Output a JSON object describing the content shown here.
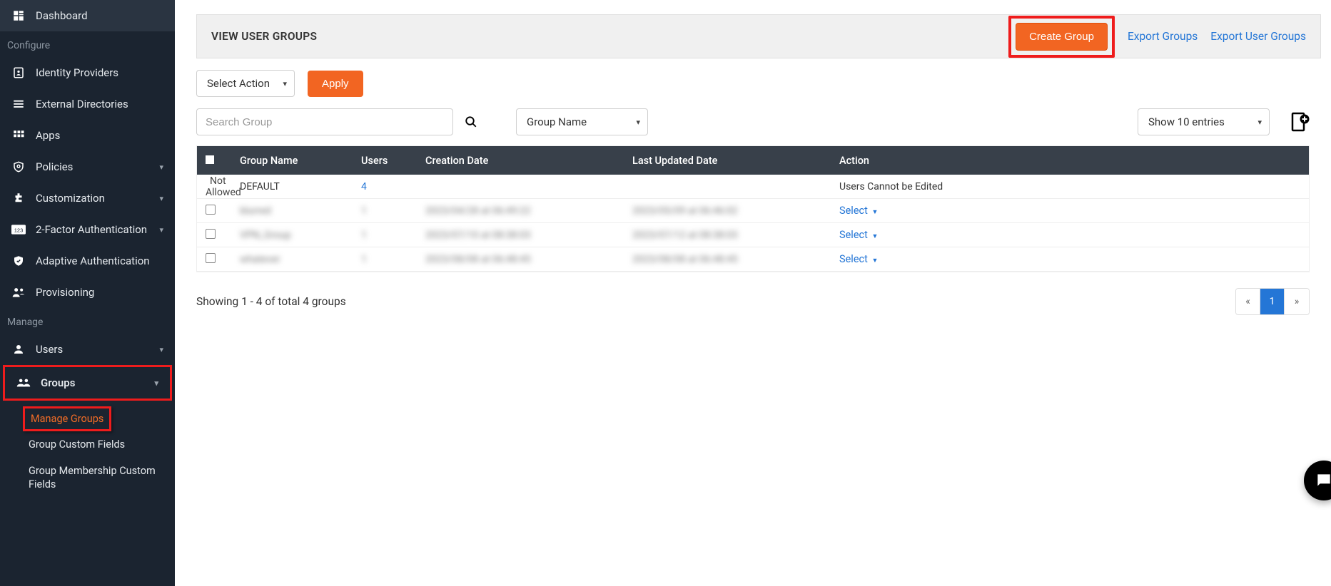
{
  "sidebar": {
    "items": [
      {
        "label": "Dashboard"
      },
      {
        "label": "Identity Providers"
      },
      {
        "label": "External Directories"
      },
      {
        "label": "Apps"
      },
      {
        "label": "Policies"
      },
      {
        "label": "Customization"
      },
      {
        "label": "2-Factor Authentication"
      },
      {
        "label": "Adaptive Authentication"
      },
      {
        "label": "Provisioning"
      },
      {
        "label": "Users"
      },
      {
        "label": "Groups"
      }
    ],
    "section_configure": "Configure",
    "section_manage": "Manage",
    "sub": {
      "manage_groups": "Manage Groups",
      "group_custom_fields": "Group Custom Fields",
      "group_membership": "Group Membership Custom Fields"
    }
  },
  "header": {
    "title": "VIEW USER GROUPS",
    "create": "Create Group",
    "export_groups": "Export Groups",
    "export_user_groups": "Export User Groups"
  },
  "controls": {
    "select_action": "Select Action",
    "apply": "Apply"
  },
  "filter": {
    "search_placeholder": "Search Group",
    "group_name": "Group Name",
    "show_entries": "Show 10 entries"
  },
  "table": {
    "headers": {
      "group_name": "Group Name",
      "users": "Users",
      "creation": "Creation Date",
      "updated": "Last Updated Date",
      "action": "Action"
    },
    "rows": [
      {
        "check_text": "Not Allowed",
        "name": "DEFAULT",
        "users": "4",
        "users_link": true,
        "created": "",
        "updated": "",
        "action_text": "Users Cannot be Edited"
      },
      {
        "name": "blurred",
        "users": "1",
        "created": "2023/04/28 at 06:49:22",
        "updated": "2023/05/09 at 06:46:02",
        "action_text": "Select"
      },
      {
        "name": "VPN_Group",
        "users": "1",
        "created": "2023/07/10 at 08:38:03",
        "updated": "2023/07/12 at 08:38:03",
        "action_text": "Select"
      },
      {
        "name": "whatever",
        "users": "1",
        "created": "2023/08/08 at 06:48:45",
        "updated": "2023/08/08 at 06:48:45",
        "action_text": "Select"
      }
    ]
  },
  "footer": {
    "showing": "Showing 1 - 4 of total 4 groups",
    "page": "1",
    "prev": "«",
    "next": "»"
  }
}
